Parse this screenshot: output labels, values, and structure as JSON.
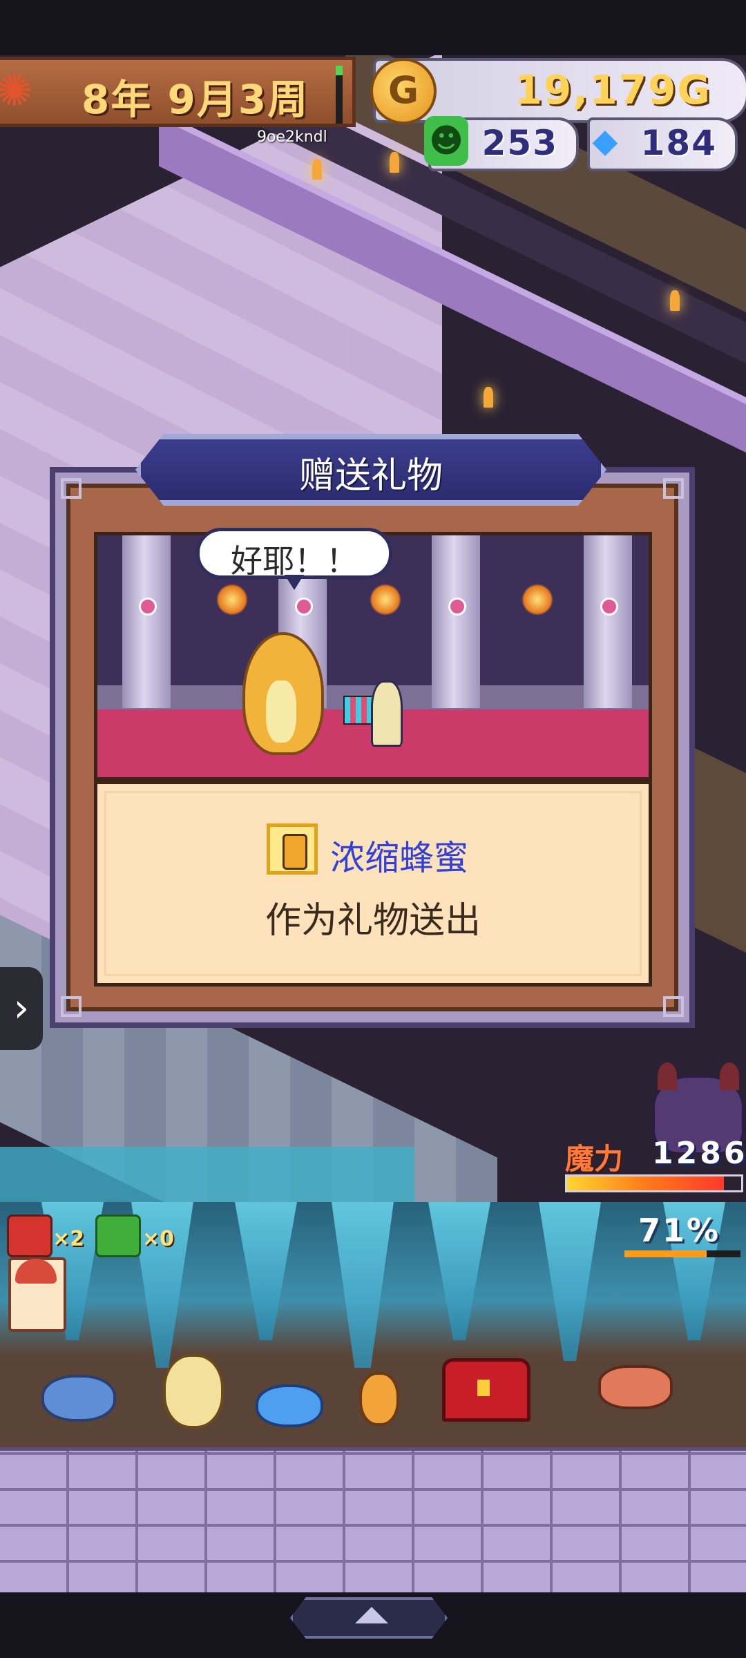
{
  "hud": {
    "date": "8年 9月3周",
    "gold": "19,179G",
    "resource_green": "253",
    "resource_crystal": "184",
    "username": "9oe2kndl"
  },
  "dialog": {
    "title": "赠送礼物",
    "speech": "好耶！！",
    "item_name": "浓缩蜂蜜",
    "message": "作为礼物送出"
  },
  "mana": {
    "label": "魔力",
    "value": "1286",
    "fill_fraction": 0.9
  },
  "bottom": {
    "chest_count": "×2",
    "gift_count": "×0",
    "percent": "71%",
    "percent_fraction": 0.71
  },
  "colors": {
    "title_bar": "#2b2c6e",
    "item_name": "#3140d8",
    "gold_text": "#ffd35a"
  }
}
